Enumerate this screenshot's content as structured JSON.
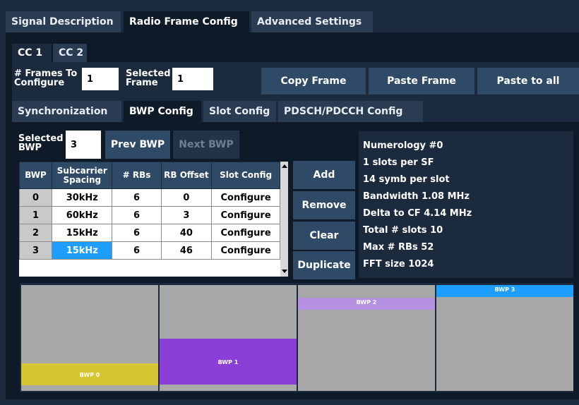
{
  "top_tabs": [
    "Signal Description",
    "Radio Frame Config",
    "Advanced Settings"
  ],
  "cc_tabs": [
    "CC 1",
    "CC 2"
  ],
  "frames": {
    "frames_to_configure_label_1": "# Frames To",
    "frames_to_configure_label_2": "Configure",
    "frames_to_configure_value": "1",
    "selected_frame_label_1": "Selected",
    "selected_frame_label_2": "Frame",
    "selected_frame_value": "1",
    "copy_frame": "Copy Frame",
    "paste_frame": "Paste Frame",
    "paste_to_all": "Paste to all"
  },
  "sub_tabs": [
    "Synchronization",
    "BWP Config",
    "Slot Config",
    "PDSCH/PDCCH Config"
  ],
  "bwp": {
    "selected_label_1": "Selected",
    "selected_label_2": "BWP",
    "selected_value": "3",
    "prev": "Prev BWP",
    "next": "Next BWP",
    "headers": [
      "BWP",
      "Subcarrier Spacing",
      "# RBs",
      "RB Offset",
      "Slot Config"
    ],
    "rows": [
      [
        "0",
        "30kHz",
        "6",
        "0",
        "Configure"
      ],
      [
        "1",
        "60kHz",
        "6",
        "3",
        "Configure"
      ],
      [
        "2",
        "15kHz",
        "6",
        "40",
        "Configure"
      ],
      [
        "3",
        "15kHz",
        "6",
        "46",
        "Configure"
      ]
    ],
    "actions": [
      "Add",
      "Remove",
      "Clear",
      "Duplicate"
    ]
  },
  "info": [
    "Numerology #0",
    "1 slots per SF",
    "14 symb per slot",
    "Bandwidth 1.08 MHz",
    "Delta to CF 4.14 MHz",
    "Total # slots 10",
    "Max # RBs 52",
    "FFT size 1024"
  ],
  "bwp_blocks": [
    {
      "label": "BWP 0",
      "color": "#d6c632",
      "rb_start": 0,
      "rb_count": 6
    },
    {
      "label": "BWP 1",
      "color": "#8b3fd6",
      "rb_start": 3,
      "rb_count": 6
    },
    {
      "label": "BWP 2",
      "color": "#b58fe0",
      "rb_start": 40,
      "rb_count": 6
    },
    {
      "label": "BWP 3",
      "color": "#1e9fff",
      "rb_start": 46,
      "rb_count": 6
    }
  ],
  "colors": {
    "accent": "#1e9fff",
    "panel": "#0e1a28",
    "button": "#2f4a67"
  }
}
